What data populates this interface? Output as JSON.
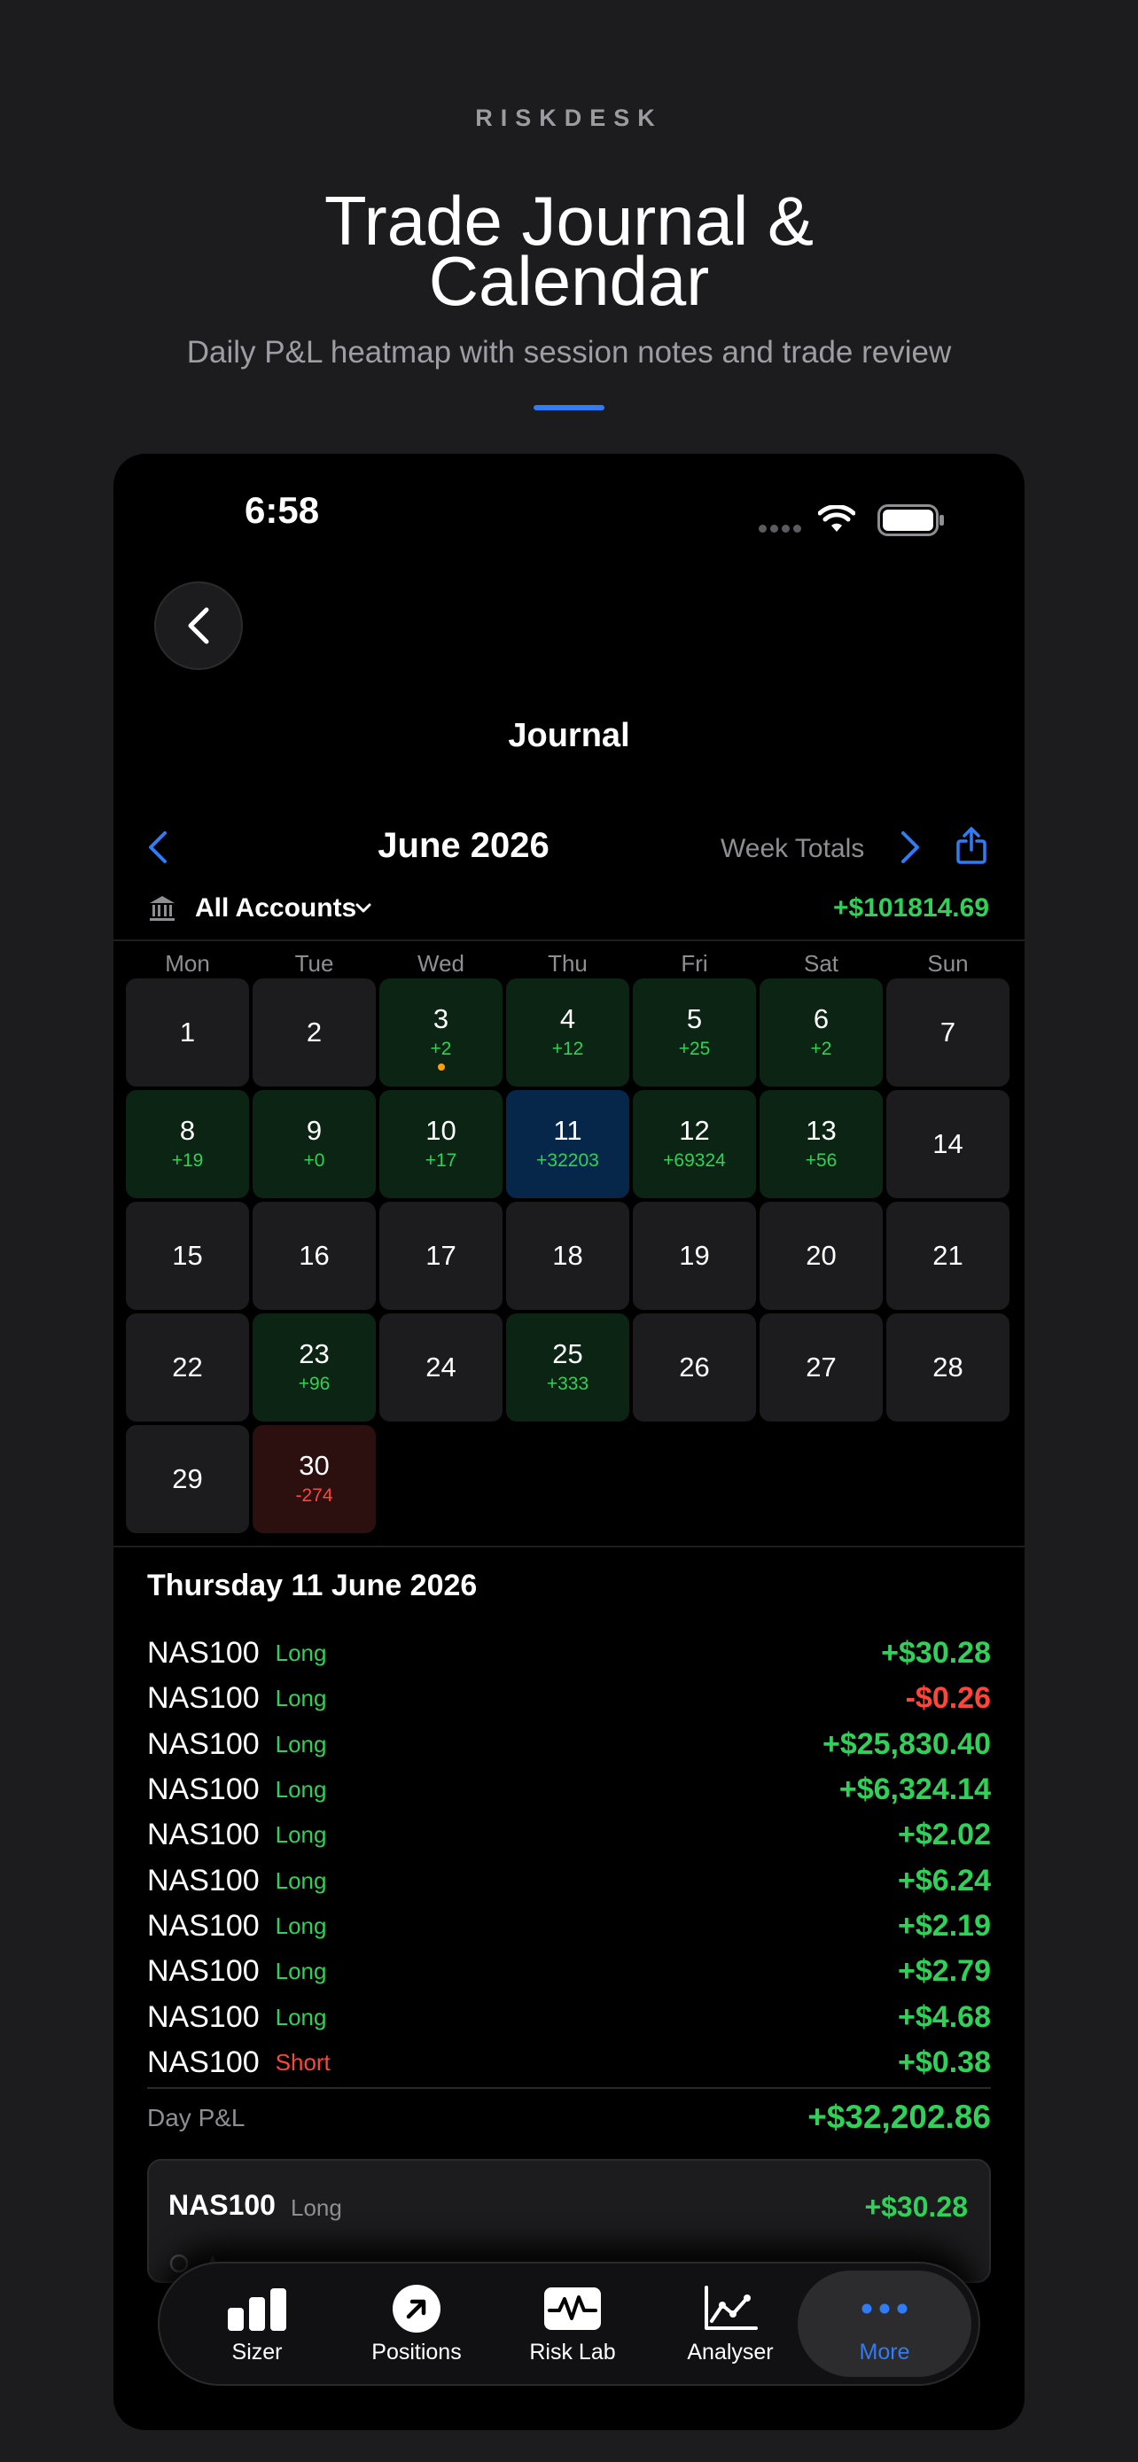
{
  "brand": "RISKDESK",
  "hero": {
    "title_line1": "Trade Journal &",
    "title_line2": "Calendar",
    "subtitle": "Daily P&L heatmap with session notes and trade review",
    "accent": "#2f7cf6"
  },
  "status_bar": {
    "time": "6:58"
  },
  "nav": {
    "title": "Journal",
    "back_icon": "chevron-left-icon"
  },
  "calendar": {
    "month": "June 2026",
    "week_totals_label": "Week Totals",
    "account_label": "All Accounts",
    "account_total": "+$101814.69",
    "weekdays": [
      "Mon",
      "Tue",
      "Wed",
      "Thu",
      "Fri",
      "Sat",
      "Sun"
    ],
    "days": [
      {
        "n": "1",
        "pnl": "",
        "state": "none"
      },
      {
        "n": "2",
        "pnl": "",
        "state": "none"
      },
      {
        "n": "3",
        "pnl": "+2",
        "state": "pos",
        "note": true
      },
      {
        "n": "4",
        "pnl": "+12",
        "state": "pos"
      },
      {
        "n": "5",
        "pnl": "+25",
        "state": "pos"
      },
      {
        "n": "6",
        "pnl": "+2",
        "state": "pos"
      },
      {
        "n": "7",
        "pnl": "",
        "state": "none"
      },
      {
        "n": "8",
        "pnl": "+19",
        "state": "pos"
      },
      {
        "n": "9",
        "pnl": "+0",
        "state": "pos"
      },
      {
        "n": "10",
        "pnl": "+17",
        "state": "pos"
      },
      {
        "n": "11",
        "pnl": "+32203",
        "state": "sel"
      },
      {
        "n": "12",
        "pnl": "+69324",
        "state": "pos"
      },
      {
        "n": "13",
        "pnl": "+56",
        "state": "pos"
      },
      {
        "n": "14",
        "pnl": "",
        "state": "none"
      },
      {
        "n": "15",
        "pnl": "",
        "state": "none"
      },
      {
        "n": "16",
        "pnl": "",
        "state": "none"
      },
      {
        "n": "17",
        "pnl": "",
        "state": "none"
      },
      {
        "n": "18",
        "pnl": "",
        "state": "none"
      },
      {
        "n": "19",
        "pnl": "",
        "state": "none"
      },
      {
        "n": "20",
        "pnl": "",
        "state": "none"
      },
      {
        "n": "21",
        "pnl": "",
        "state": "none"
      },
      {
        "n": "22",
        "pnl": "",
        "state": "none"
      },
      {
        "n": "23",
        "pnl": "+96",
        "state": "pos"
      },
      {
        "n": "24",
        "pnl": "",
        "state": "none"
      },
      {
        "n": "25",
        "pnl": "+333",
        "state": "pos"
      },
      {
        "n": "26",
        "pnl": "",
        "state": "none"
      },
      {
        "n": "27",
        "pnl": "",
        "state": "none"
      },
      {
        "n": "28",
        "pnl": "",
        "state": "none"
      },
      {
        "n": "29",
        "pnl": "",
        "state": "none"
      },
      {
        "n": "30",
        "pnl": "-274",
        "state": "neg"
      }
    ]
  },
  "detail": {
    "heading": "Thursday 11 June 2026",
    "trades": [
      {
        "symbol": "NAS100",
        "side": "Long",
        "amount": "+$30.28"
      },
      {
        "symbol": "NAS100",
        "side": "Long",
        "amount": "-$0.26"
      },
      {
        "symbol": "NAS100",
        "side": "Long",
        "amount": "+$25,830.40"
      },
      {
        "symbol": "NAS100",
        "side": "Long",
        "amount": "+$6,324.14"
      },
      {
        "symbol": "NAS100",
        "side": "Long",
        "amount": "+$2.02"
      },
      {
        "symbol": "NAS100",
        "side": "Long",
        "amount": "+$6.24"
      },
      {
        "symbol": "NAS100",
        "side": "Long",
        "amount": "+$2.19"
      },
      {
        "symbol": "NAS100",
        "side": "Long",
        "amount": "+$2.79"
      },
      {
        "symbol": "NAS100",
        "side": "Long",
        "amount": "+$4.68"
      },
      {
        "symbol": "NAS100",
        "side": "Short",
        "amount": "+$0.38"
      }
    ],
    "day_pnl_label": "Day P&L",
    "day_pnl_value": "+$32,202.86",
    "card": {
      "symbol": "NAS100",
      "side": "Long",
      "amount": "+$30.28"
    }
  },
  "tabs": [
    {
      "label": "Sizer",
      "icon": "bar-chart-icon"
    },
    {
      "label": "Positions",
      "icon": "arrow-up-right-circle-icon"
    },
    {
      "label": "Risk Lab",
      "icon": "waveform-icon"
    },
    {
      "label": "Analyser",
      "icon": "line-chart-icon"
    },
    {
      "label": "More",
      "icon": "ellipsis-icon",
      "active": true
    }
  ],
  "colors": {
    "positive": "#30d158",
    "negative": "#ff453a",
    "accent": "#2f7cf6",
    "note": "#ff9f0a"
  }
}
